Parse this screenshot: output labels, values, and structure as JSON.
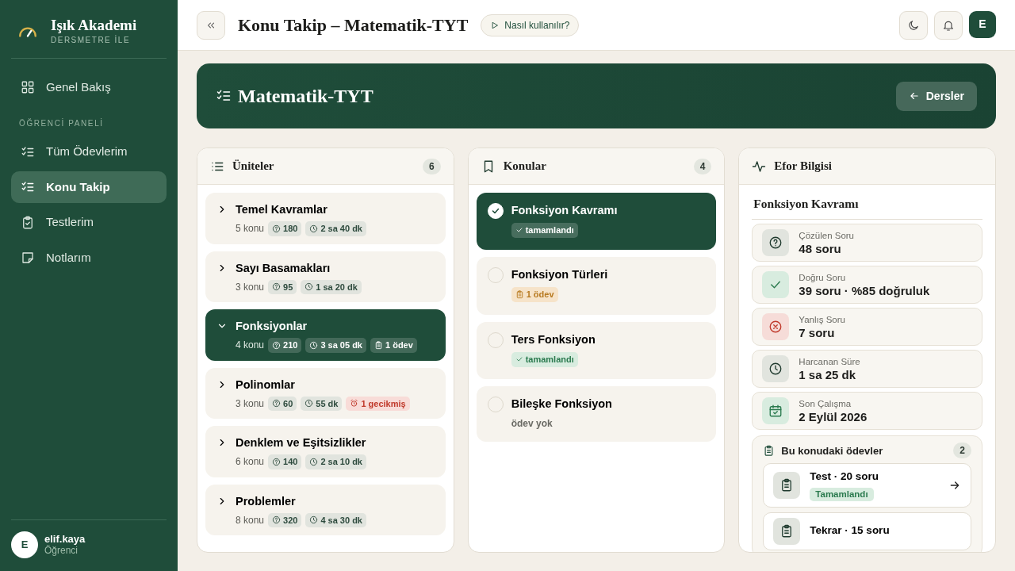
{
  "sidebar": {
    "brand": {
      "title": "Işık Akademi",
      "subtitle": "DERSMETRE İLE"
    },
    "items": [
      {
        "label": "Genel Bakış",
        "selected": false
      },
      {
        "kind": "section",
        "label": "ÖĞRENCİ PANELİ"
      },
      {
        "label": "Tüm Ödevlerim",
        "selected": false
      },
      {
        "label": "Konu Takip",
        "selected": true
      },
      {
        "label": "Testlerim",
        "selected": false
      },
      {
        "label": "Notlarım",
        "selected": false
      }
    ],
    "user": {
      "initial": "E",
      "name": "elif.kaya",
      "role": "Öğrenci"
    }
  },
  "header": {
    "title": "Konu Takip – Matematik-TYT",
    "help": "Nasıl kullanılır?",
    "avatar": "E"
  },
  "hero": {
    "title": "Matematik-TYT",
    "back": "Dersler"
  },
  "units": {
    "title": "Üniteler",
    "count": "6",
    "items": [
      {
        "name": "Temel Kavramlar",
        "topics": "5 konu",
        "selected": false,
        "expanded": false,
        "chips": [
          {
            "kind": "questions",
            "text": "180"
          },
          {
            "kind": "time",
            "text": "2 sa 40 dk"
          }
        ]
      },
      {
        "name": "Sayı Basamakları",
        "topics": "3 konu",
        "selected": false,
        "expanded": false,
        "chips": [
          {
            "kind": "questions",
            "text": "95"
          },
          {
            "kind": "time",
            "text": "1 sa 20 dk"
          }
        ]
      },
      {
        "name": "Fonksiyonlar",
        "topics": "4 konu",
        "selected": true,
        "expanded": true,
        "chips": [
          {
            "kind": "questions",
            "text": "210"
          },
          {
            "kind": "time",
            "text": "3 sa 05 dk"
          },
          {
            "kind": "homework",
            "text": "1 ödev"
          }
        ]
      },
      {
        "name": "Polinomlar",
        "topics": "3 konu",
        "selected": false,
        "expanded": false,
        "chips": [
          {
            "kind": "questions",
            "text": "60"
          },
          {
            "kind": "time",
            "text": "55 dk"
          },
          {
            "kind": "overdue",
            "text": "1 gecikmiş"
          }
        ]
      },
      {
        "name": "Denklem ve Eşitsizlikler",
        "topics": "6 konu",
        "selected": false,
        "expanded": false,
        "chips": [
          {
            "kind": "questions",
            "text": "140"
          },
          {
            "kind": "time",
            "text": "2 sa 10 dk"
          }
        ]
      },
      {
        "name": "Problemler",
        "topics": "8 konu",
        "selected": false,
        "expanded": false,
        "chips": [
          {
            "kind": "questions",
            "text": "320"
          },
          {
            "kind": "time",
            "text": "4 sa 30 dk"
          }
        ]
      }
    ]
  },
  "topics": {
    "title": "Konular",
    "count": "4",
    "items": [
      {
        "name": "Fonksiyon Kavramı",
        "selected": true,
        "checked": true,
        "tag": {
          "kind": "done",
          "text": "tamamlandı"
        }
      },
      {
        "name": "Fonksiyon Türleri",
        "selected": false,
        "checked": false,
        "tag": {
          "kind": "homework",
          "text": "1 ödev"
        }
      },
      {
        "name": "Ters Fonksiyon",
        "selected": false,
        "checked": false,
        "tag": {
          "kind": "done",
          "text": "tamamlandı"
        }
      },
      {
        "name": "Bileşke Fonksiyon",
        "selected": false,
        "checked": false,
        "tag": {
          "kind": "none",
          "text": "ödev yok"
        }
      }
    ]
  },
  "effort": {
    "title": "Efor Bilgisi",
    "topic": "Fonksiyon Kavramı",
    "stats": [
      {
        "kind": "solved",
        "label": "Çözülen Soru",
        "value": "48 soru"
      },
      {
        "kind": "correct",
        "label": "Doğru Soru",
        "value": "39 soru · %85 doğruluk"
      },
      {
        "kind": "wrong",
        "label": "Yanlış Soru",
        "value": "7 soru"
      },
      {
        "kind": "time",
        "label": "Harcanan Süre",
        "value": "1 sa 25 dk"
      },
      {
        "kind": "date",
        "label": "Son Çalışma",
        "value": "2 Eylül 2026"
      }
    ],
    "homework": {
      "title": "Bu konudaki ödevler",
      "count": "2",
      "items": [
        {
          "title": "Test · 20 soru",
          "status": "Tamamlandı"
        },
        {
          "title": "Tekrar · 15 soru"
        }
      ]
    }
  }
}
